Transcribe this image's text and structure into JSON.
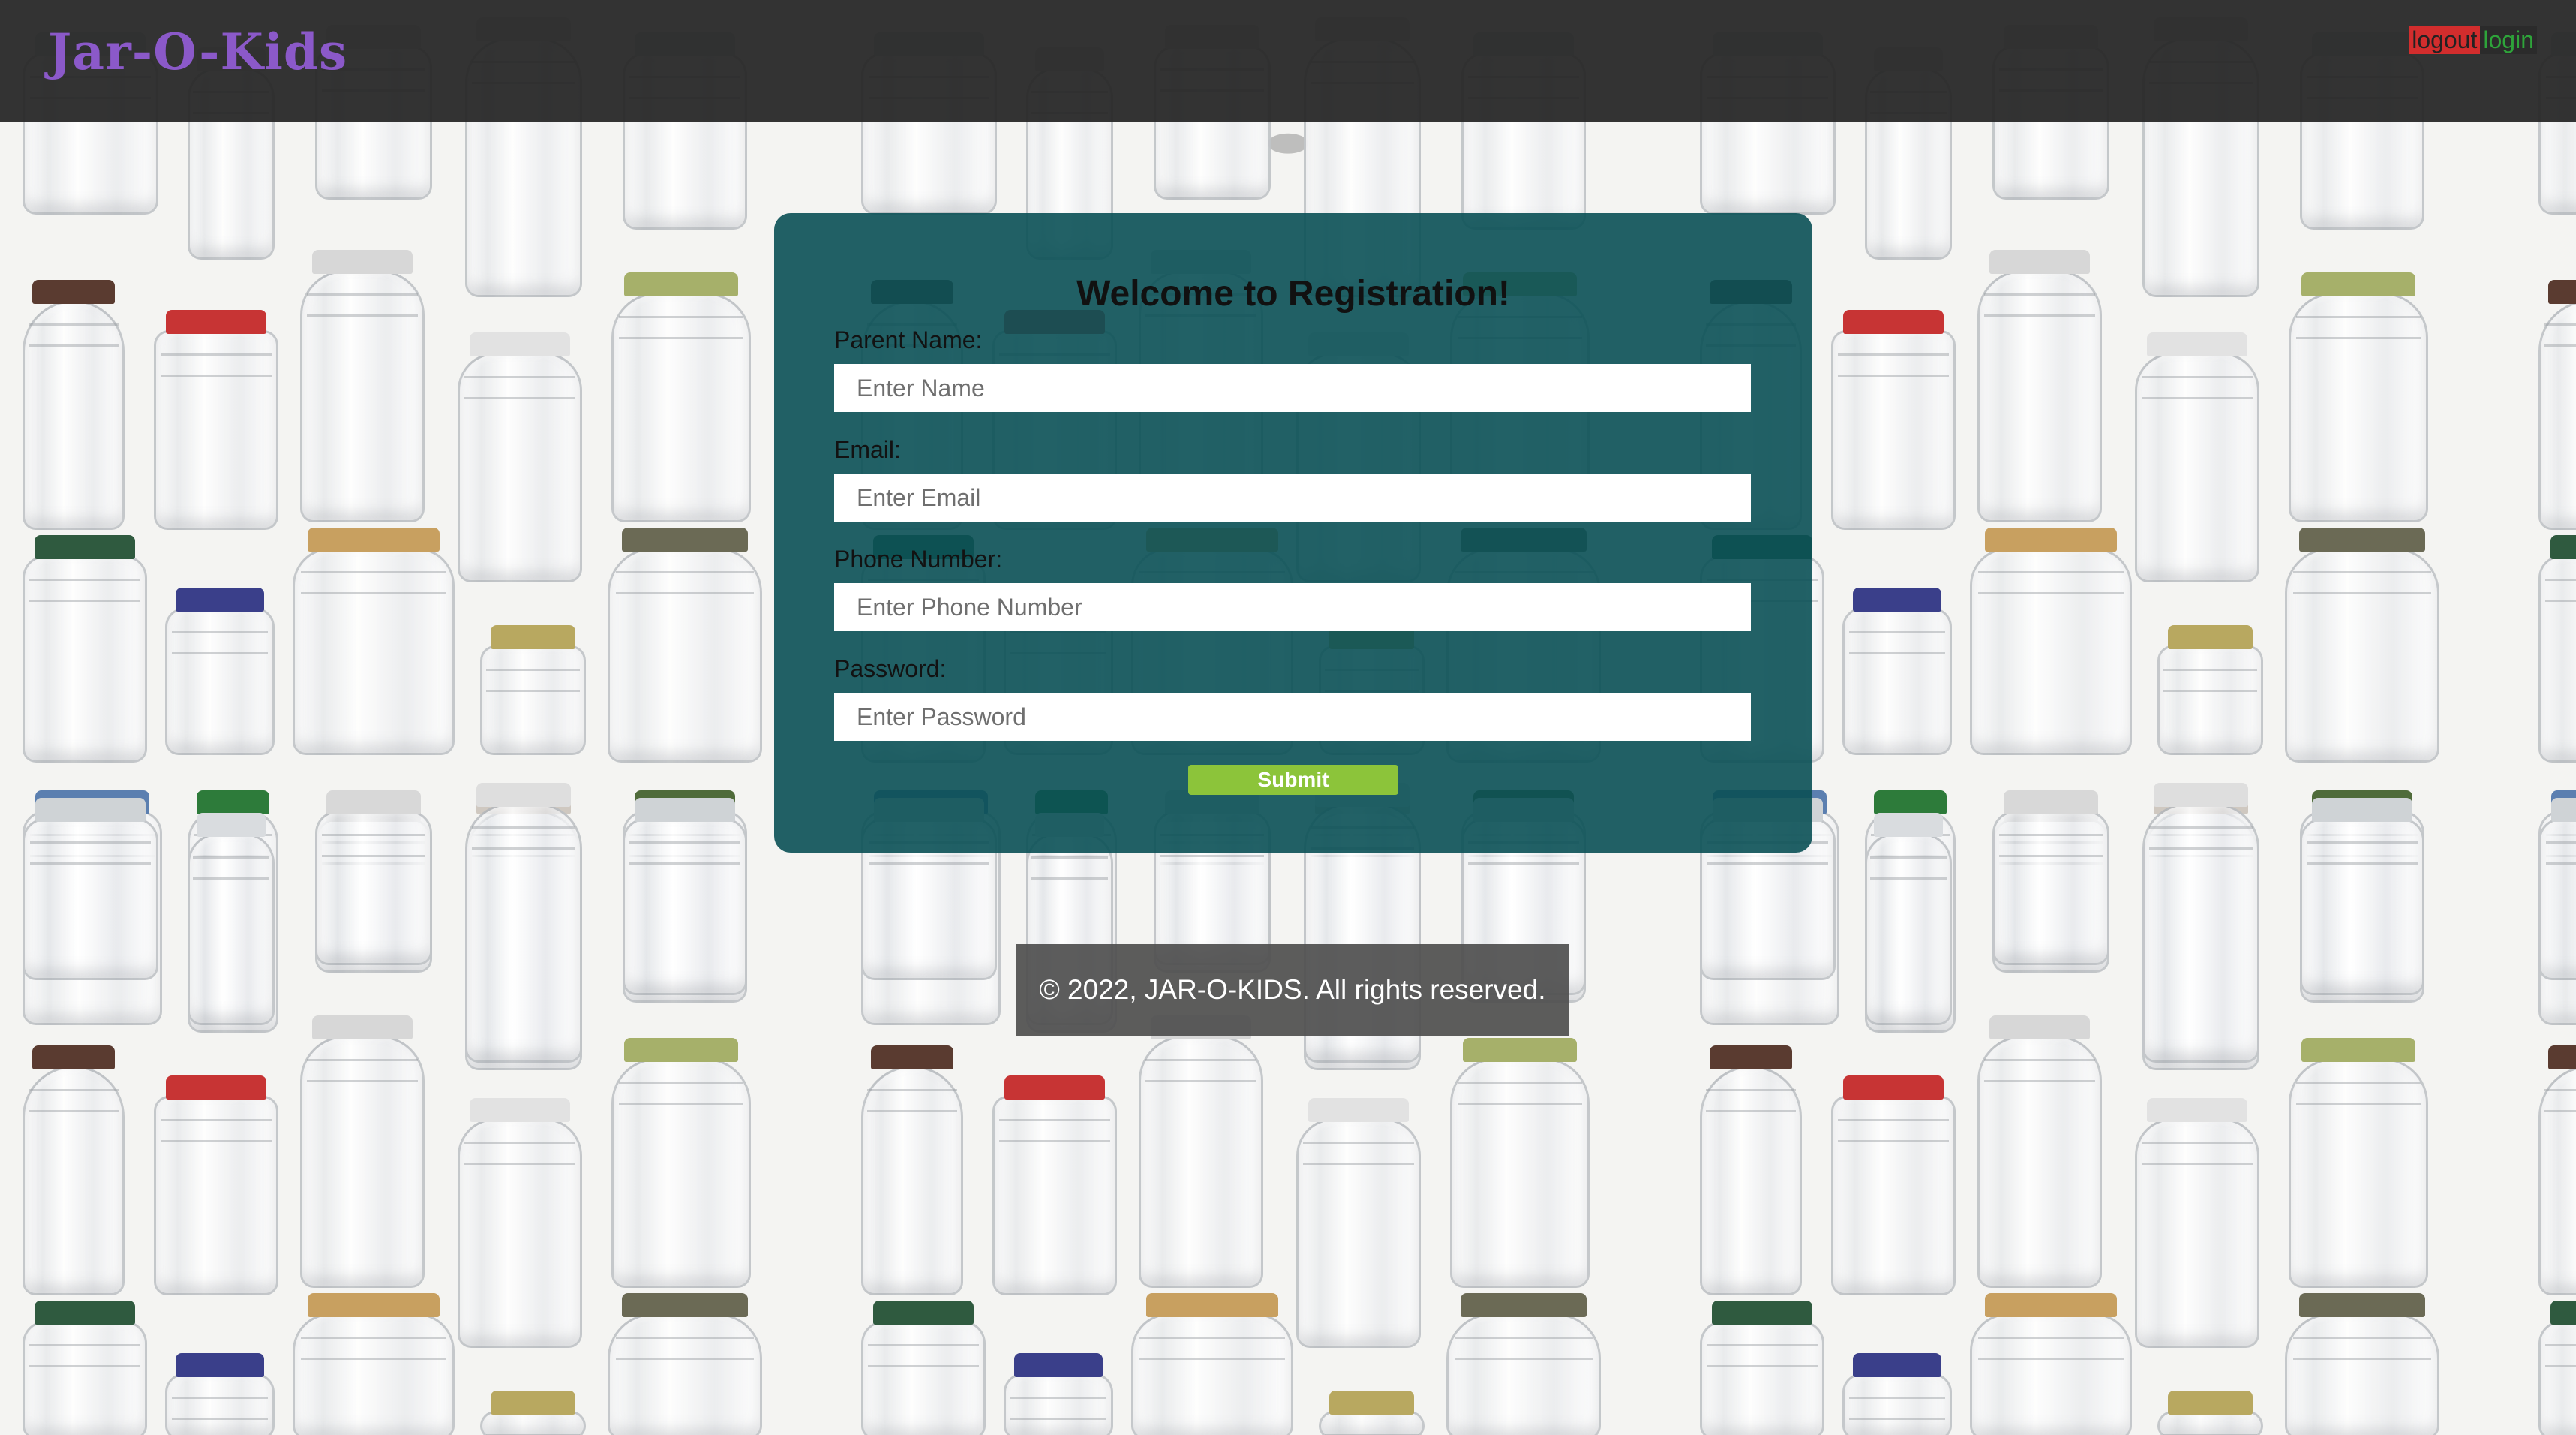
{
  "header": {
    "brand": "Jar-O-Kids",
    "logout_label": "logout",
    "login_label": "login"
  },
  "registration": {
    "title": "Welcome to Registration!",
    "fields": [
      {
        "label": "Parent Name:",
        "placeholder": "Enter Name"
      },
      {
        "label": "Email:",
        "placeholder": "Enter Email"
      },
      {
        "label": "Phone Number:",
        "placeholder": "Enter Phone Number"
      },
      {
        "label": "Password:",
        "placeholder": "Enter Password"
      }
    ],
    "submit_label": "Submit"
  },
  "footer": {
    "copyright": "© 2022, JAR-O-KIDS. All rights reserved."
  },
  "colors": {
    "header_bg": "#262626",
    "brand": "#8b59c9",
    "card_bg": "#0a5055",
    "submit_bg": "#8cc43a",
    "logout_bg": "#d22d2d",
    "login_text": "#2ea43a",
    "footer_bg": "#505050"
  },
  "background": {
    "image": "glass-jars-wallpaper"
  }
}
